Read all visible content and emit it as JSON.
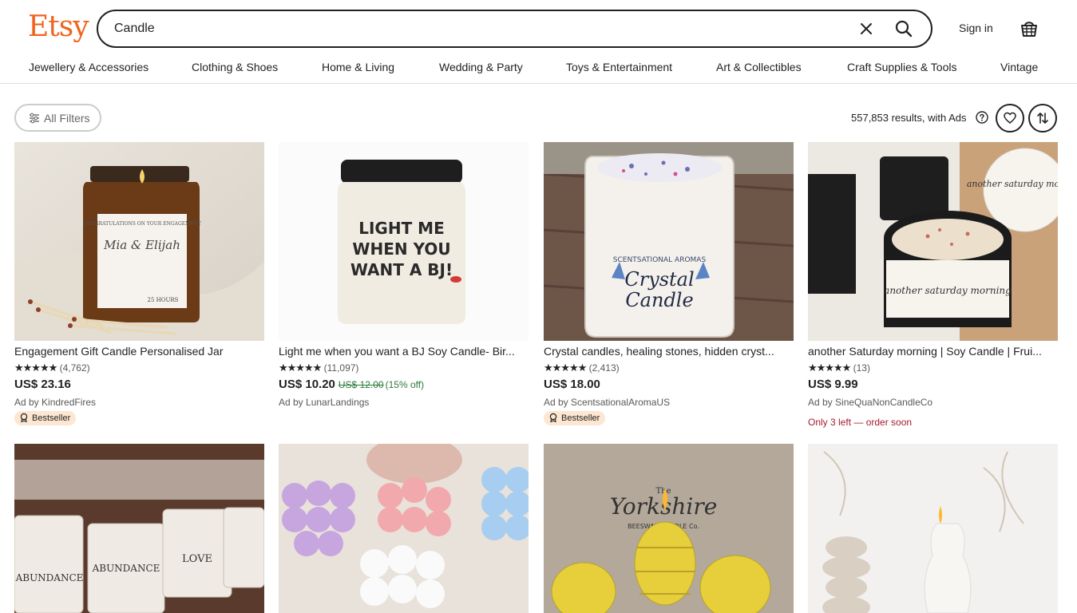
{
  "brand": {
    "logo": "Etsy",
    "color": "#F1641E"
  },
  "search": {
    "value": "Candle",
    "clear_icon": "close-icon",
    "submit_icon": "search-icon"
  },
  "header": {
    "sign_in": "Sign in",
    "cart_icon": "basket-icon"
  },
  "categories": [
    "Jewellery & Accessories",
    "Clothing & Shoes",
    "Home & Living",
    "Wedding & Party",
    "Toys & Entertainment",
    "Art & Collectibles",
    "Craft Supplies & Tools",
    "Vintage"
  ],
  "toolbar": {
    "filters_label": "All Filters",
    "results": "557,853 results, with Ads",
    "favorite_icon": "heart-icon",
    "sort_icon": "sort-icon"
  },
  "listings": [
    {
      "title": "Engagement Gift Candle Personalised Jar",
      "stars": "★★★★★",
      "reviews": "(4,762)",
      "price": "US$ 23.16",
      "ad": "Ad by KindredFires",
      "badge": "Bestseller",
      "image_text": [
        "CONGRATULATIONS ON YOUR ENGAGEMENT",
        "Mia & Elijah",
        "25 HOURS"
      ]
    },
    {
      "title": "Light me when you want a BJ Soy Candle- Bir...",
      "stars": "★★★★★",
      "reviews": "(11,097)",
      "price": "US$ 10.20",
      "original_price": "US$ 12.00",
      "discount": "(15% off)",
      "ad": "Ad by LunarLandings",
      "image_text": [
        "LIGHT ME",
        "WHEN YOU",
        "WANT A BJ!"
      ]
    },
    {
      "title": "Crystal candles, healing stones, hidden cryst...",
      "stars": "★★★★★",
      "reviews": "(2,413)",
      "price": "US$ 18.00",
      "ad": "Ad by ScentsationalAromaUS",
      "badge": "Bestseller",
      "image_text": [
        "SCENTSATIONAL AROMAS",
        "Crystal",
        "Candle"
      ]
    },
    {
      "title": "another Saturday morning | Soy Candle | Frui...",
      "stars": "★★★★★",
      "reviews": "(13)",
      "price": "US$ 9.99",
      "ad": "Ad by SineQuaNonCandleCo",
      "stock": "Only 3 left — order soon",
      "image_text": [
        "another saturday morning",
        "another saturday morning"
      ]
    },
    {
      "image_text": [
        "ABUNDANCE",
        "ABUNDANCE",
        "LOVE"
      ]
    },
    {
      "image_text": []
    },
    {
      "image_text": [
        "The",
        "Yorkshire",
        "BEESWAX CANDLE Co."
      ]
    },
    {
      "image_text": []
    }
  ]
}
